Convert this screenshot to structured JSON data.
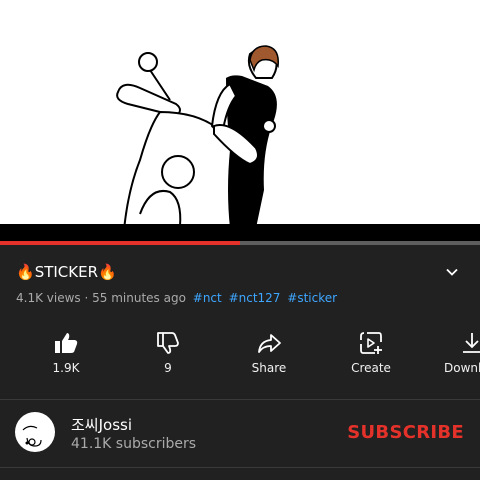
{
  "video": {
    "progress_fraction": 0.5
  },
  "title": {
    "text": "STICKER",
    "prefix_emoji": "🔥",
    "suffix_emoji": "🔥"
  },
  "meta": {
    "views": "4.1K views",
    "separator": "·",
    "time": "55 minutes ago",
    "hashtags": [
      "#nct",
      "#nct127",
      "#sticker"
    ]
  },
  "actions": [
    {
      "label": "1.9K",
      "icon": "thumbs-up-icon"
    },
    {
      "label": "9",
      "icon": "thumbs-down-icon"
    },
    {
      "label": "Share",
      "icon": "share-icon"
    },
    {
      "label": "Create",
      "icon": "create-icon"
    },
    {
      "label": "Downl",
      "icon": "download-icon"
    }
  ],
  "channel": {
    "name": "조씨Jossi",
    "subscribers": "41.1K subscribers",
    "subscribe_label": "SUBSCRIBE"
  },
  "colors": {
    "accent": "#e4322b",
    "hashtag": "#3ea6ff",
    "background": "#212121",
    "secondary_text": "#aaaaaa"
  }
}
